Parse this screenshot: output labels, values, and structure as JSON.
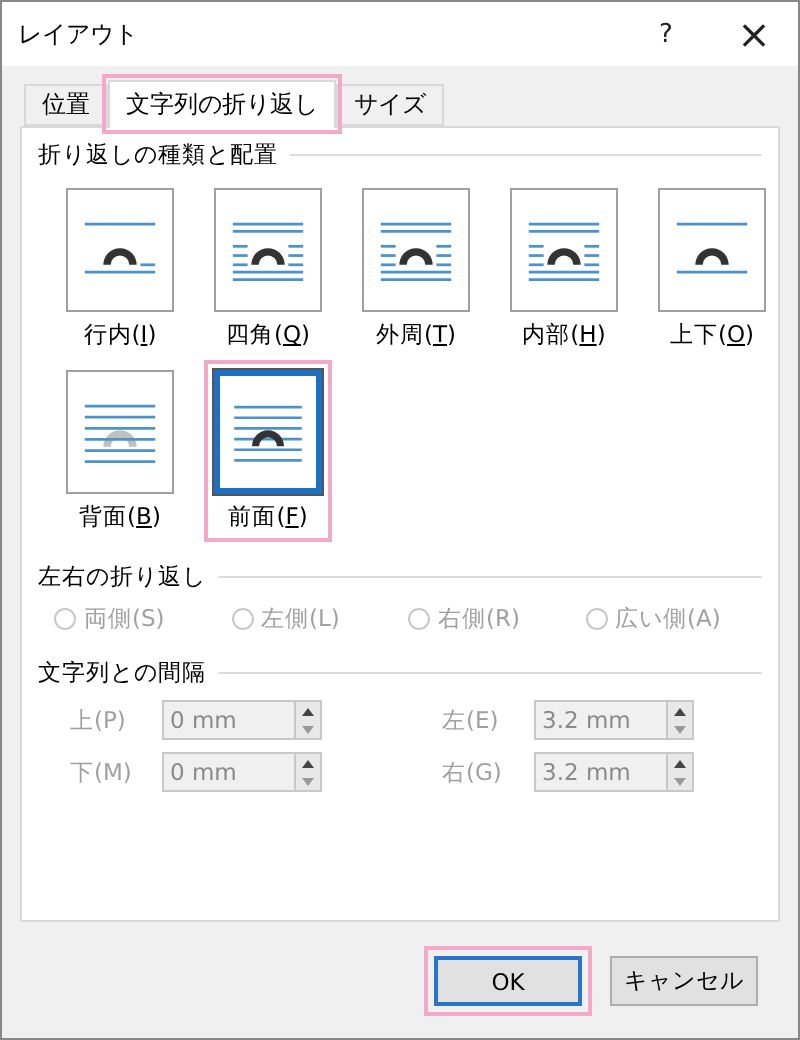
{
  "window": {
    "title": "レイアウト",
    "help": "?",
    "close": "×"
  },
  "tabs": [
    {
      "label": "位置",
      "selected": false,
      "highlighted": false
    },
    {
      "label": "文字列の折り返し",
      "selected": true,
      "highlighted": true
    },
    {
      "label": "サイズ",
      "selected": false,
      "highlighted": false
    }
  ],
  "wrap_group": {
    "title": "折り返しの種類と配置",
    "options": [
      {
        "kind": "inline",
        "label": "行内(I)",
        "selected": false,
        "highlighted": false
      },
      {
        "kind": "square",
        "label": "四角(Q)",
        "selected": false,
        "highlighted": false
      },
      {
        "kind": "tight",
        "label": "外周(T)",
        "selected": false,
        "highlighted": false
      },
      {
        "kind": "through",
        "label": "内部(H)",
        "selected": false,
        "highlighted": false
      },
      {
        "kind": "topbottom",
        "label": "上下(O)",
        "selected": false,
        "highlighted": false
      },
      {
        "kind": "behind",
        "label": "背面(B)",
        "selected": false,
        "highlighted": false
      },
      {
        "kind": "front",
        "label": "前面(F)",
        "selected": true,
        "highlighted": true
      }
    ]
  },
  "side_group": {
    "title": "左右の折り返し",
    "options": [
      {
        "label": "両側(S)",
        "selected": false,
        "disabled": true
      },
      {
        "label": "左側(L)",
        "selected": false,
        "disabled": true
      },
      {
        "label": "右側(R)",
        "selected": false,
        "disabled": true
      },
      {
        "label": "広い側(A)",
        "selected": false,
        "disabled": true
      }
    ]
  },
  "distance_group": {
    "title": "文字列との間隔",
    "fields": [
      {
        "label": "上(P)",
        "value": "0 mm",
        "disabled": true
      },
      {
        "label": "左(E)",
        "value": "3.2 mm",
        "disabled": true
      },
      {
        "label": "下(M)",
        "value": "0 mm",
        "disabled": true
      },
      {
        "label": "右(G)",
        "value": "3.2 mm",
        "disabled": true
      }
    ]
  },
  "buttons": [
    {
      "label": "OK",
      "default": true,
      "highlighted": true
    },
    {
      "label": "キャンセル",
      "default": false,
      "highlighted": false
    }
  ]
}
